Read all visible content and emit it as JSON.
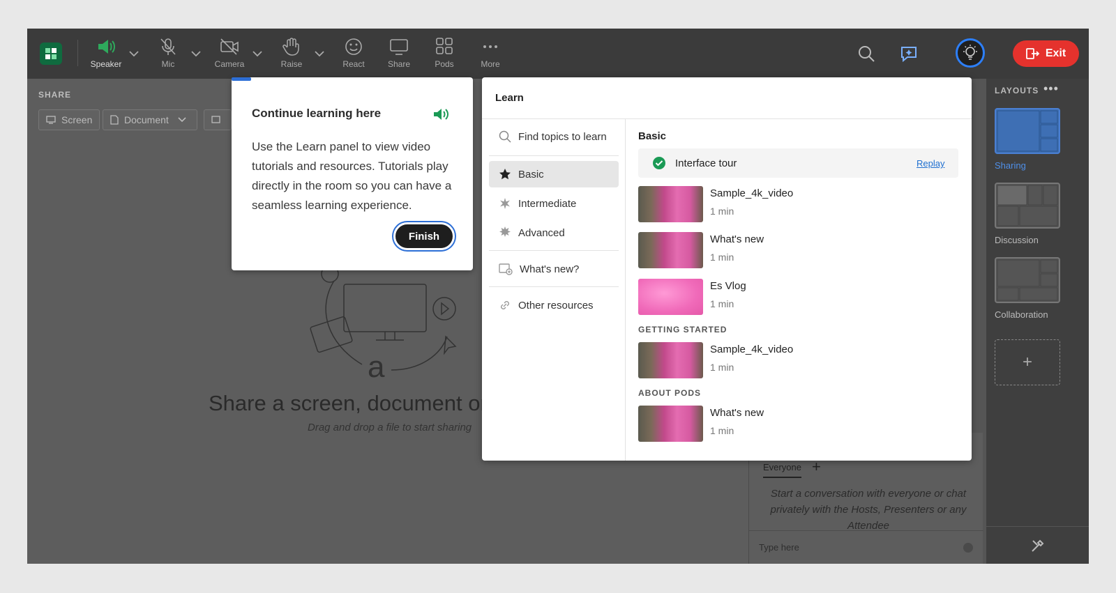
{
  "toolbar": {
    "tools": [
      {
        "name": "speaker",
        "label": "Speaker"
      },
      {
        "name": "mic",
        "label": "Mic"
      },
      {
        "name": "camera",
        "label": "Camera"
      },
      {
        "name": "raise",
        "label": "Raise"
      },
      {
        "name": "react",
        "label": "React"
      },
      {
        "name": "share",
        "label": "Share"
      },
      {
        "name": "pods",
        "label": "Pods"
      },
      {
        "name": "more",
        "label": "More"
      }
    ],
    "exit_label": "Exit",
    "accent": "#e5322d"
  },
  "share_pod": {
    "title": "SHARE",
    "buttons": {
      "screen": "Screen",
      "document": "Document"
    },
    "headline": "Share a screen, document or w",
    "subtext": "Drag and drop a file to start sharing"
  },
  "tooltip": {
    "title": "Continue learning here",
    "body": "Use the Learn panel to view video tutorials and resources. Tutorials play directly in the room so you can have a seamless learning experience.",
    "finish_label": "Finish"
  },
  "learn": {
    "title": "Learn",
    "search_placeholder": "Find topics to learn",
    "nav": [
      {
        "label": "Basic",
        "active": true
      },
      {
        "label": "Intermediate"
      },
      {
        "label": "Advanced"
      },
      {
        "label": "What's new?"
      },
      {
        "label": "Other resources"
      }
    ],
    "section_title": "Basic",
    "interface_tour": {
      "label": "Interface tour",
      "action": "Replay"
    },
    "videos": [
      {
        "title": "Sample_4k_video",
        "duration": "1 min"
      },
      {
        "title": "What's new",
        "duration": "1 min"
      },
      {
        "title": "Es Vlog",
        "duration": "1 min"
      }
    ],
    "getting_started": {
      "title": "GETTING STARTED",
      "videos": [
        {
          "title": "Sample_4k_video",
          "duration": "1 min"
        }
      ]
    },
    "about_pods": {
      "title": "ABOUT PODS",
      "videos": [
        {
          "title": "What's new",
          "duration": "1 min"
        }
      ]
    }
  },
  "chat": {
    "tab": "Everyone",
    "empty_message": "Start a conversation with everyone or chat privately with the Hosts, Presenters or any Attendee",
    "input_placeholder": "Type here"
  },
  "layouts": {
    "title": "LAYOUTS",
    "items": [
      {
        "label": "Sharing",
        "active": true
      },
      {
        "label": "Discussion"
      },
      {
        "label": "Collaboration"
      }
    ]
  }
}
